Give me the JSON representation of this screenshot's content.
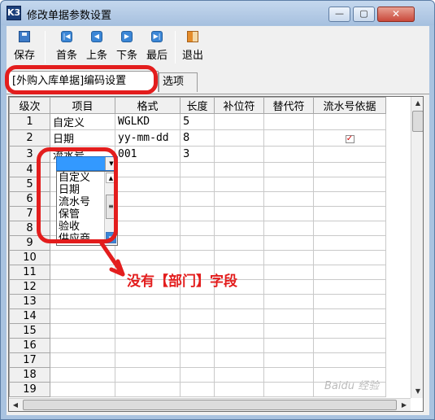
{
  "window": {
    "title": "修改单据参数设置",
    "app_icon_label": "K3",
    "minimize": "—",
    "maximize": "▢",
    "close": "✕"
  },
  "toolbar": {
    "save_label": "保存",
    "first_label": "首条",
    "prev_label": "上条",
    "next_label": "下条",
    "last_label": "最后",
    "exit_label": "退出"
  },
  "tabs": [
    {
      "label": "[外购入库单据]编码设置",
      "active": true
    },
    {
      "label": "选项",
      "active": false
    }
  ],
  "grid": {
    "columns": [
      "级次",
      "项目",
      "格式",
      "长度",
      "补位符",
      "替代符",
      "流水号依据"
    ],
    "rows": [
      {
        "num": "1",
        "item": "自定义",
        "format": "WGLKD",
        "length": "5",
        "pad": "",
        "replace": "",
        "serial_basis": ""
      },
      {
        "num": "2",
        "item": "日期",
        "format": "yy-mm-dd",
        "length": "8",
        "pad": "",
        "replace": "",
        "serial_basis": "checked"
      },
      {
        "num": "3",
        "item": "流水号",
        "format": "001",
        "length": "3",
        "pad": "",
        "replace": "",
        "serial_basis": ""
      },
      {
        "num": "4",
        "item": "",
        "format": "",
        "length": "",
        "pad": "",
        "replace": "",
        "serial_basis": ""
      },
      {
        "num": "5",
        "item": "",
        "format": "",
        "length": "",
        "pad": "",
        "replace": "",
        "serial_basis": ""
      },
      {
        "num": "6",
        "item": "",
        "format": "",
        "length": "",
        "pad": "",
        "replace": "",
        "serial_basis": ""
      },
      {
        "num": "7",
        "item": "",
        "format": "",
        "length": "",
        "pad": "",
        "replace": "",
        "serial_basis": ""
      },
      {
        "num": "8",
        "item": "",
        "format": "",
        "length": "",
        "pad": "",
        "replace": "",
        "serial_basis": ""
      },
      {
        "num": "9",
        "item": "",
        "format": "",
        "length": "",
        "pad": "",
        "replace": "",
        "serial_basis": ""
      },
      {
        "num": "10",
        "item": "",
        "format": "",
        "length": "",
        "pad": "",
        "replace": "",
        "serial_basis": ""
      },
      {
        "num": "11",
        "item": "",
        "format": "",
        "length": "",
        "pad": "",
        "replace": "",
        "serial_basis": ""
      },
      {
        "num": "12",
        "item": "",
        "format": "",
        "length": "",
        "pad": "",
        "replace": "",
        "serial_basis": ""
      },
      {
        "num": "13",
        "item": "",
        "format": "",
        "length": "",
        "pad": "",
        "replace": "",
        "serial_basis": ""
      },
      {
        "num": "14",
        "item": "",
        "format": "",
        "length": "",
        "pad": "",
        "replace": "",
        "serial_basis": ""
      },
      {
        "num": "15",
        "item": "",
        "format": "",
        "length": "",
        "pad": "",
        "replace": "",
        "serial_basis": ""
      },
      {
        "num": "16",
        "item": "",
        "format": "",
        "length": "",
        "pad": "",
        "replace": "",
        "serial_basis": ""
      },
      {
        "num": "17",
        "item": "",
        "format": "",
        "length": "",
        "pad": "",
        "replace": "",
        "serial_basis": ""
      },
      {
        "num": "18",
        "item": "",
        "format": "",
        "length": "",
        "pad": "",
        "replace": "",
        "serial_basis": ""
      },
      {
        "num": "19",
        "item": "",
        "format": "",
        "length": "",
        "pad": "",
        "replace": "",
        "serial_basis": ""
      }
    ]
  },
  "dropdown": {
    "current_value": "",
    "options": [
      "自定义",
      "日期",
      "流水号",
      "保管",
      "验收",
      "供应商"
    ]
  },
  "annotation": {
    "text": "没有【部门】字段",
    "color": "#e31d1d"
  },
  "watermark": "Baidu 经验"
}
